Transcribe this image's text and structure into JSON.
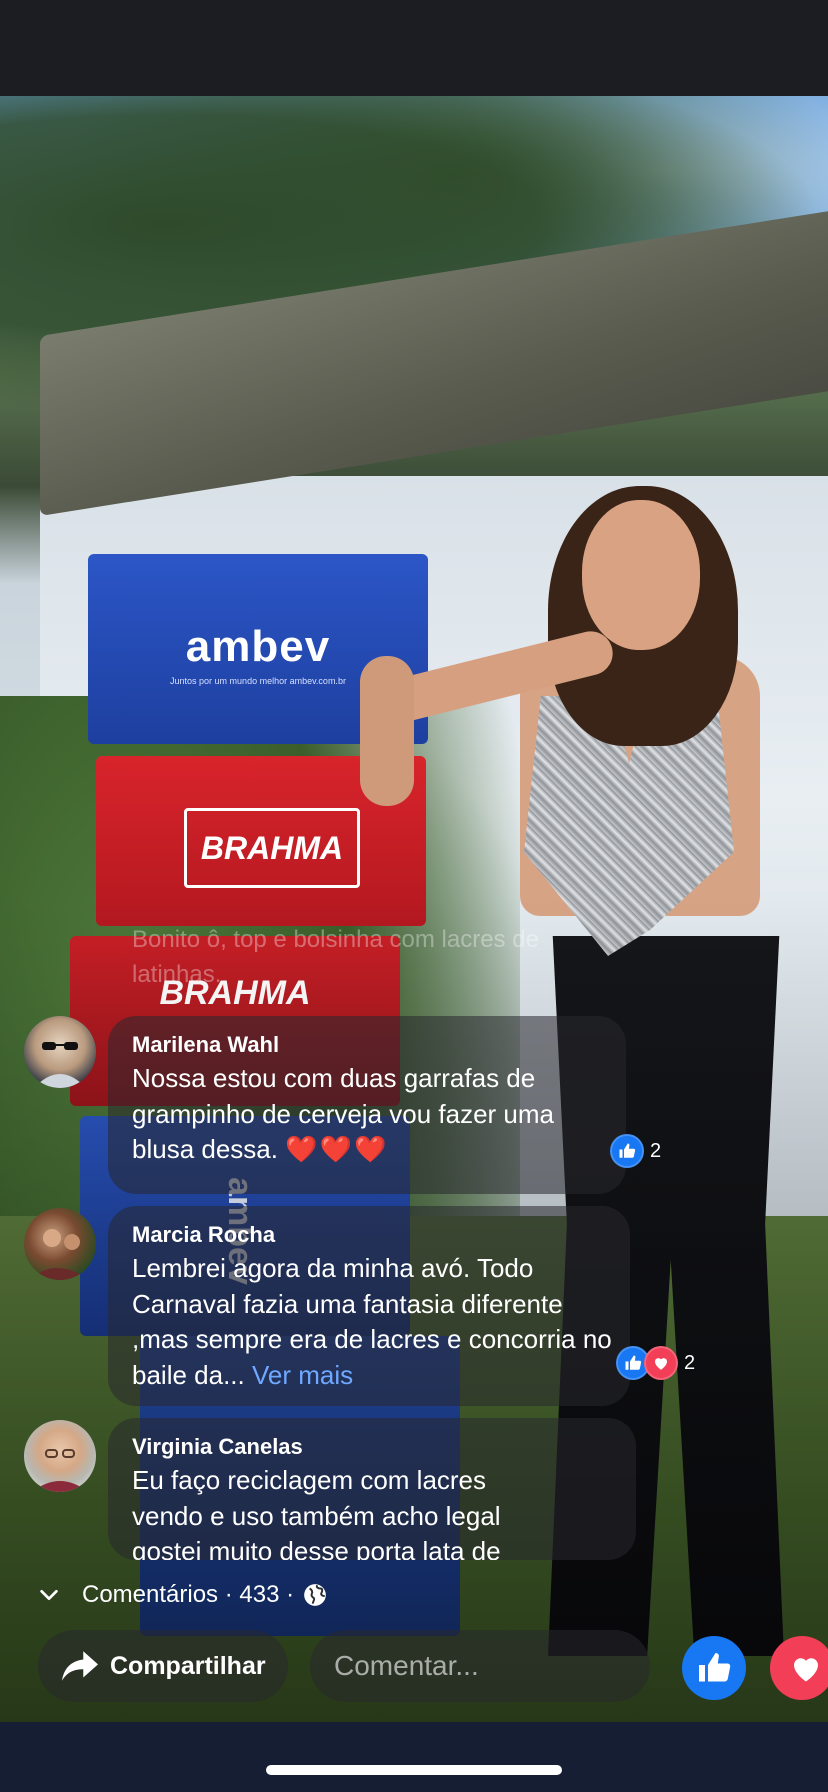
{
  "video": {
    "crate_ambev_text": "ambev",
    "crate_ambev_sub": "Juntos por um mundo melhor ambev.com.br",
    "crate_brahma_text": "BRAHMA",
    "crate_blue_side_text": "ambev"
  },
  "ghost_comment": "Bonito ô, top e bolsinha com lacres de latinhas.",
  "comments": [
    {
      "name": "Marilena Wahl",
      "text": "Nossa estou com duas garrafas de grampinho de cerveja vou fazer uma blusa dessa.",
      "hearts": "❤️❤️❤️",
      "reaction_count": "2"
    },
    {
      "name": "Marcia Rocha",
      "text": "Lembrei agora da minha avó. Todo Carnaval fazia uma fantasia diferente ,mas sempre era de lacres e concorria no baile da...",
      "more": "Ver mais",
      "reaction_count": "2"
    },
    {
      "name": "Virginia Canelas",
      "text": "Eu faço reciclagem com lacres vendo e uso também acho legal gostei muito desse porta lata de"
    }
  ],
  "comments_bar": {
    "label": "Comentários · 433 ·"
  },
  "actions": {
    "share_label": "Compartilhar",
    "comment_placeholder": "Comentar..."
  },
  "colors": {
    "like_blue": "#1877f2",
    "love_red": "#f33e58",
    "link_blue": "#6ea8ff"
  }
}
